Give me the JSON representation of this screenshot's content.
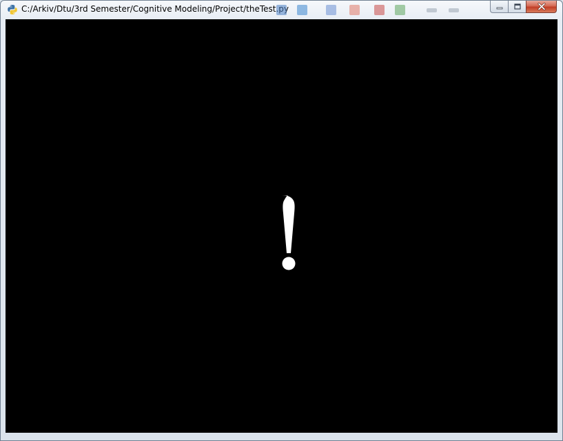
{
  "window": {
    "title": "C:/Arkiv/Dtu/3rd Semester/Cognitive Modeling/Project/theTest.py",
    "app_icon": "python-icon",
    "caption_buttons": [
      {
        "name": "minimize",
        "icon": "minimize-icon"
      },
      {
        "name": "maximize",
        "icon": "maximize-icon"
      },
      {
        "name": "close",
        "icon": "close-icon"
      }
    ]
  },
  "canvas": {
    "background_color": "#000000",
    "stimulus": {
      "glyph": "exclamation-mark",
      "color": "#ffffff"
    }
  },
  "colors": {
    "close_button": "#c94a32",
    "frame": "#dbe3ec"
  }
}
